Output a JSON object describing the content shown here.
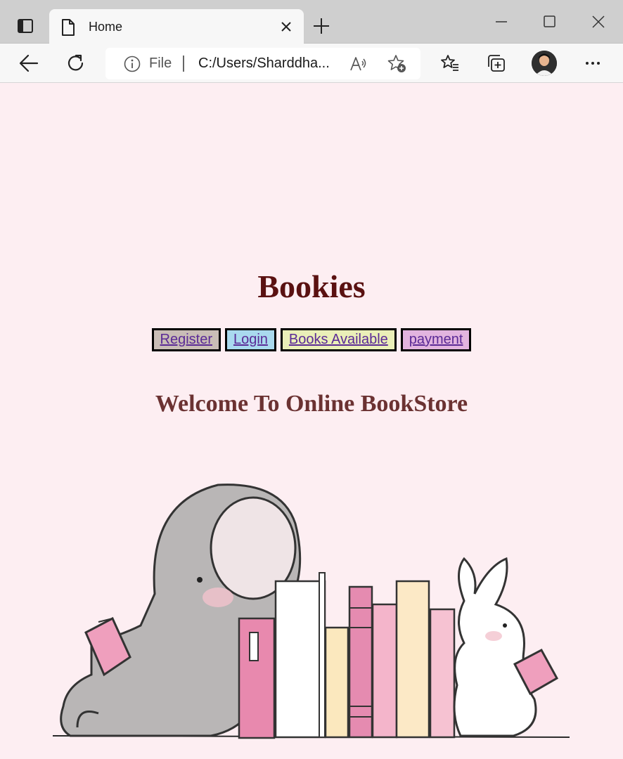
{
  "browser": {
    "tab_title": "Home",
    "address": {
      "scheme_label": "File",
      "url": "C:/Users/Sharddha..."
    },
    "icons": {
      "tab_actions": "tab-actions-icon",
      "tab_page": "page-icon",
      "tab_close": "close-icon",
      "new_tab": "plus-icon",
      "minimize": "minimize-icon",
      "maximize": "maximize-icon",
      "close_window": "close-icon",
      "back": "back-arrow-icon",
      "refresh": "refresh-icon",
      "site_info": "info-icon",
      "read_aloud": "read-aloud-icon",
      "add_favorite": "add-favorite-icon",
      "favorites": "favorites-icon",
      "collections": "collections-icon",
      "profile": "avatar",
      "menu": "more-icon"
    }
  },
  "page": {
    "title": "Bookies",
    "nav": [
      {
        "label": "Register",
        "bg": "#c9bdb6"
      },
      {
        "label": "Login",
        "bg": "#a9d9ee"
      },
      {
        "label": "Books Available",
        "bg": "#eaefb8"
      },
      {
        "label": "payment",
        "bg": "#e2b4df"
      }
    ],
    "welcome": "Welcome To Online BookStore",
    "illustration": "elephant-and-bunny-reading-beside-books"
  },
  "colors": {
    "page_bg": "#fdeef2",
    "title": "#5a1111",
    "welcome": "#6b3232",
    "link": "#5b2a96"
  }
}
